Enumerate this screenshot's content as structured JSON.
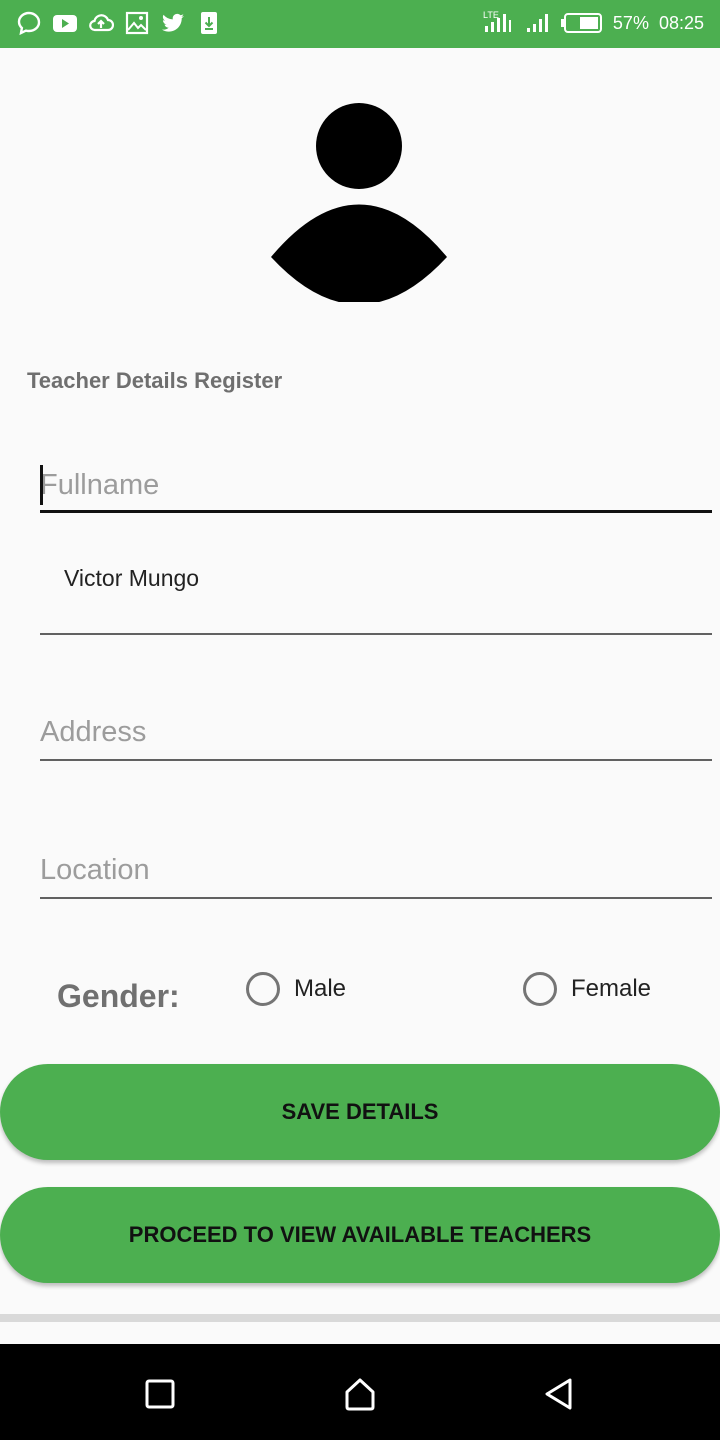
{
  "status_bar": {
    "network": "LTE",
    "battery": "57%",
    "time": "08:25",
    "notification_icons": [
      "message-icon",
      "youtube-icon",
      "cloud-upload-icon",
      "image-icon",
      "twitter-icon",
      "download-icon"
    ],
    "color": "#4caf50"
  },
  "form": {
    "title": "Teacher Details Register",
    "fullname_placeholder": "Fullname",
    "name_value": "Victor Mungo",
    "address_placeholder": "Address",
    "location_placeholder": "Location",
    "gender_label": "Gender:",
    "gender_options": [
      "Male",
      "Female"
    ]
  },
  "buttons": {
    "save": "SAVE DETAILS",
    "proceed": "PROCEED TO VIEW AVAILABLE TEACHERS",
    "color": "#4caf50"
  },
  "nav": {
    "recents": "recents-icon",
    "home": "home-icon",
    "back": "back-icon"
  }
}
